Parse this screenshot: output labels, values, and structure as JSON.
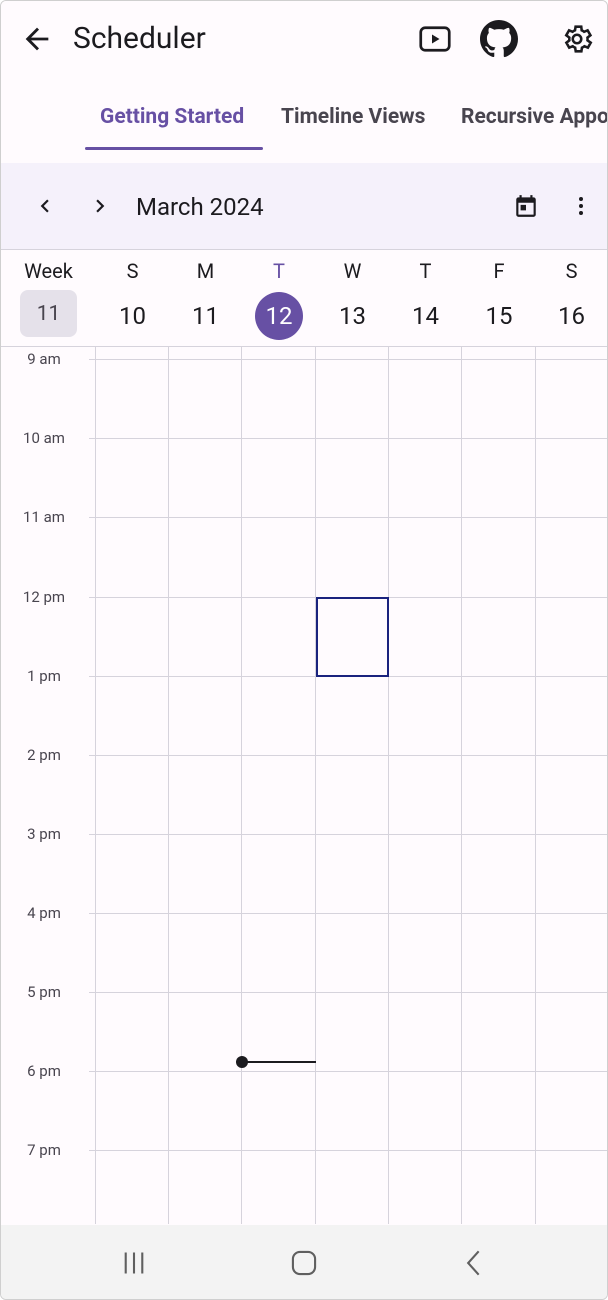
{
  "app_bar": {
    "title": "Scheduler",
    "icons": [
      "back-arrow-icon",
      "youtube-play-icon",
      "github-icon",
      "settings-gear-icon"
    ]
  },
  "tabs": [
    {
      "label": "Getting Started",
      "active": true
    },
    {
      "label": "Timeline Views",
      "active": false
    },
    {
      "label": "Recursive Appo",
      "active": false
    }
  ],
  "calendar_header": {
    "month_label": "March 2024",
    "icons": [
      "chevron-left-icon",
      "chevron-right-icon",
      "calendar-icon",
      "more-vertical-icon"
    ]
  },
  "week": {
    "label": "Week",
    "number": "11"
  },
  "days": [
    {
      "name": "S",
      "date": "10",
      "today": false
    },
    {
      "name": "M",
      "date": "11",
      "today": false
    },
    {
      "name": "T",
      "date": "12",
      "today": true
    },
    {
      "name": "W",
      "date": "13",
      "today": false
    },
    {
      "name": "T",
      "date": "14",
      "today": false
    },
    {
      "name": "F",
      "date": "15",
      "today": false
    },
    {
      "name": "S",
      "date": "16",
      "today": false
    }
  ],
  "time_slots": [
    "9 am",
    "10 am",
    "11 am",
    "12 pm",
    "1 pm",
    "2 pm",
    "3 pm",
    "4 pm",
    "5 pm",
    "6 pm",
    "7 pm"
  ],
  "selection": {
    "day": "13",
    "start": "12 pm",
    "end": "1 pm"
  },
  "current_time_indicator": {
    "day": "12"
  },
  "colors": {
    "accent": "#6750a4",
    "selection_border": "#1a237e",
    "grid_line": "#d6d3dc"
  },
  "system_nav": {
    "icons": [
      "recent-apps-icon",
      "home-icon",
      "system-back-icon"
    ]
  }
}
